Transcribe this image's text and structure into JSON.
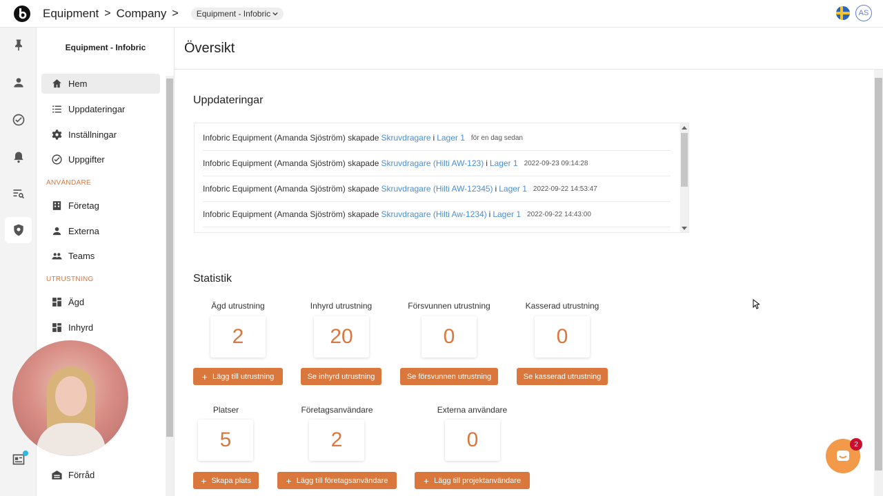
{
  "topbar": {
    "app": "Equipment",
    "company": "Company",
    "workspace": "Equipment - Infobric",
    "user_initials": "AS"
  },
  "subnav": {
    "title": "Equipment - Infobric",
    "items": [
      {
        "label": "Hem",
        "icon": "home-icon"
      },
      {
        "label": "Uppdateringar",
        "icon": "list-icon"
      },
      {
        "label": "Inställningar",
        "icon": "gear-icon"
      },
      {
        "label": "Uppgifter",
        "icon": "check-circle-icon"
      }
    ],
    "section_users": "ANVÄNDARE",
    "user_items": [
      {
        "label": "Företag",
        "icon": "company-icon"
      },
      {
        "label": "Externa",
        "icon": "person-icon"
      },
      {
        "label": "Teams",
        "icon": "group-icon"
      }
    ],
    "section_equipment": "UTRUSTNING",
    "equipment_items": [
      {
        "label": "Ägd",
        "icon": "grid-icon"
      },
      {
        "label": "Inhyrd",
        "icon": "grid-icon"
      }
    ],
    "bottom_item": {
      "label": "Förråd",
      "icon": "warehouse-icon"
    }
  },
  "page": {
    "title": "Översikt"
  },
  "updates": {
    "heading": "Uppdateringar",
    "rows": [
      {
        "actor": "Infobric Equipment (Amanda Sjöström) skapade",
        "item": "Skruvdragare",
        "sep": "i",
        "location": "Lager 1",
        "time": "för en dag sedan"
      },
      {
        "actor": "Infobric Equipment (Amanda Sjöström) skapade",
        "item": "Skruvdragare (Hilti AW-123)",
        "sep": "i",
        "location": "Lager 1",
        "time": "2022-09-23 09:14:28"
      },
      {
        "actor": "Infobric Equipment (Amanda Sjöström) skapade",
        "item": "Skruvdragare (Hilti AW-12345)",
        "sep": "i",
        "location": "Lager 1",
        "time": "2022-09-22 14:53:47"
      },
      {
        "actor": "Infobric Equipment (Amanda Sjöström) skapade",
        "item": "Skruvdragare (Hilti Aw-1234)",
        "sep": "i",
        "location": "Lager 1",
        "time": "2022-09-22 14:43:00"
      }
    ]
  },
  "stats": {
    "heading": "Statistik",
    "cards": [
      {
        "label": "Ägd utrustning",
        "value": "2",
        "button": "Lägg till utrustning",
        "plus": true
      },
      {
        "label": "Inhyrd utrustning",
        "value": "20",
        "button": "Se inhyrd utrustning",
        "plus": false
      },
      {
        "label": "Försvunnen utrustning",
        "value": "0",
        "button": "Se försvunnen utrustning",
        "plus": false
      },
      {
        "label": "Kasserad utrustning",
        "value": "0",
        "button": "Se kasserad utrustning",
        "plus": false
      },
      {
        "label": "Platser",
        "value": "5",
        "button": "Skapa plats",
        "plus": true
      },
      {
        "label": "Företagsanvändare",
        "value": "2",
        "button": "Lägg till företagsanvändare",
        "plus": true
      },
      {
        "label": "Externa användare",
        "value": "0",
        "button": "Lägg till projektanvändare",
        "plus": true
      }
    ]
  },
  "chat": {
    "badge": "2"
  },
  "colors": {
    "accent": "#d9773c",
    "link": "#4a8fd8"
  }
}
